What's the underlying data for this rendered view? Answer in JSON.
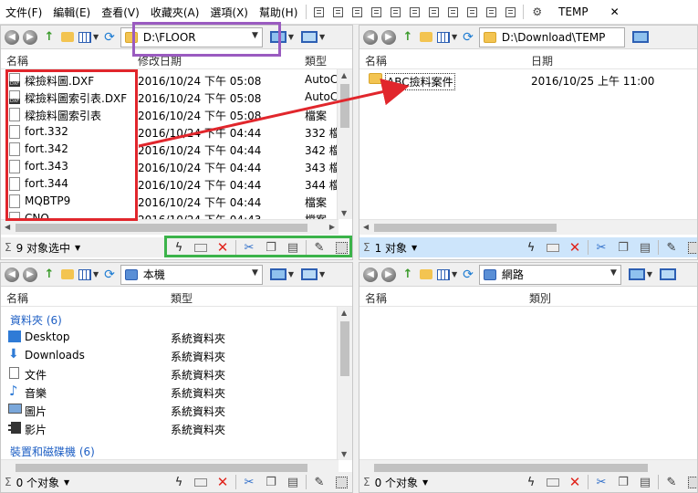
{
  "menubar": {
    "items": [
      "文件(F)",
      "編輯(E)",
      "查看(V)",
      "收藏夾(A)",
      "選項(X)",
      "幫助(H)"
    ],
    "temp_tab": "TEMP"
  },
  "pane_tl": {
    "address": "D:\\FLOOR",
    "columns": {
      "name": "名稱",
      "date": "修改日期",
      "type": "類型"
    },
    "rows": [
      {
        "name": "樑撿料圖.DXF",
        "date": "2016/10/24 下午 05:08",
        "type": "AutoC."
      },
      {
        "name": "樑撿料圖索引表.DXF",
        "date": "2016/10/24 下午 05:08",
        "type": "AutoC."
      },
      {
        "name": "樑撿料圖索引表",
        "date": "2016/10/24 下午 05:08",
        "type": "檔案"
      },
      {
        "name": "fort.332",
        "date": "2016/10/24 下午 04:44",
        "type": "332 檔"
      },
      {
        "name": "fort.342",
        "date": "2016/10/24 下午 04:44",
        "type": "342 檔"
      },
      {
        "name": "fort.343",
        "date": "2016/10/24 下午 04:44",
        "type": "343 檔"
      },
      {
        "name": "fort.344",
        "date": "2016/10/24 下午 04:44",
        "type": "344 檔"
      },
      {
        "name": "MQBTP9",
        "date": "2016/10/24 下午 04:44",
        "type": "檔案"
      },
      {
        "name": "CNO",
        "date": "2016/10/24 下午 04:43",
        "type": "檔案"
      }
    ],
    "status": "9 对象选中"
  },
  "pane_tr": {
    "address": "D:\\Download\\TEMP",
    "columns": {
      "name": "名稱",
      "date": "日期"
    },
    "rows": [
      {
        "name": "ABC撿料案件",
        "date": "2016/10/25 上午 11:00"
      }
    ],
    "status": "1 对象"
  },
  "pane_bl": {
    "address": "本機",
    "columns": {
      "name": "名稱",
      "type": "類型"
    },
    "group1": "資料夾 (6)",
    "rows": [
      {
        "name": "Desktop",
        "type": "系統資料夾"
      },
      {
        "name": "Downloads",
        "type": "系統資料夾"
      },
      {
        "name": "文件",
        "type": "系統資料夾"
      },
      {
        "name": "音樂",
        "type": "系統資料夾"
      },
      {
        "name": "圖片",
        "type": "系統資料夾"
      },
      {
        "name": "影片",
        "type": "系統資料夾"
      }
    ],
    "group2": "裝置和磁碟機 (6)",
    "status": "0 个对象"
  },
  "pane_br": {
    "address": "網路",
    "columns": {
      "name": "名稱",
      "category": "類別"
    },
    "status": "0 个对象"
  },
  "colors": {
    "annotation_red": "#e1262c",
    "annotation_purple": "#9a5bc0",
    "annotation_green": "#3bb34a",
    "active_status": "#cde5fb"
  }
}
